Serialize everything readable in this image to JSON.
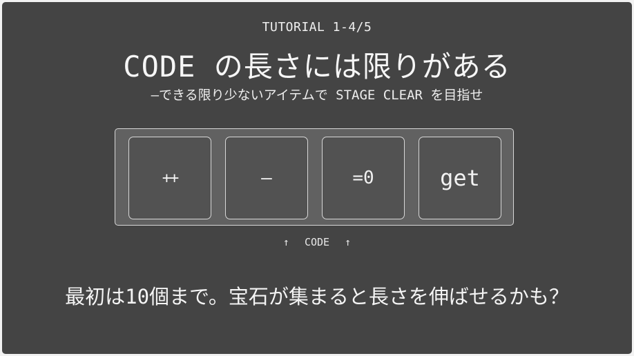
{
  "header": {
    "tutorial_step": "TUTORIAL 1-4/5",
    "title": "CODE の長さには限りがある",
    "subtitle": "—できる限り少ないアイテムで STAGE CLEAR を目指せ"
  },
  "code_panel": {
    "slots": [
      {
        "label": "++"
      },
      {
        "label": "—"
      },
      {
        "label": "=0"
      },
      {
        "label": "get"
      }
    ],
    "caption": {
      "left_arrow": "↑",
      "text": "CODE",
      "right_arrow": "↑"
    }
  },
  "hint": "最初は10個まで。宝石が集まると長さを伸ばせるかも？",
  "colors": {
    "background": "#444444",
    "panel": "#616161",
    "slot": "#525252",
    "border": "#d8d8d8",
    "text": "#f4f4f4"
  }
}
